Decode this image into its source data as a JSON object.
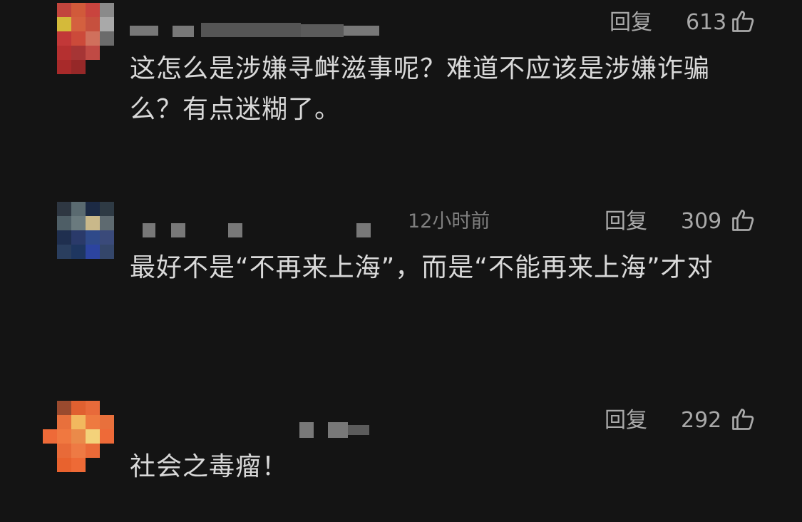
{
  "comments": [
    {
      "username": "",
      "timestamp": "",
      "text": "这怎么是涉嫌寻衅滋事呢？难道不应该是涉嫌诈骗么？有点迷糊了。",
      "reply_label": "回复",
      "like_count": "613"
    },
    {
      "username": "",
      "timestamp": "12小时前",
      "text": "最好不是“不再来上海”，而是“不能再来上海”才对",
      "reply_label": "回复",
      "like_count": "309"
    },
    {
      "username": "",
      "timestamp": "",
      "text": "社会之毒瘤！",
      "reply_label": "回复",
      "like_count": "292"
    }
  ],
  "colors": {
    "background": "#141414",
    "text": "#d9d9d9",
    "meta": "#a9a9a9"
  },
  "icons": {
    "like": "thumbs-up-icon"
  }
}
